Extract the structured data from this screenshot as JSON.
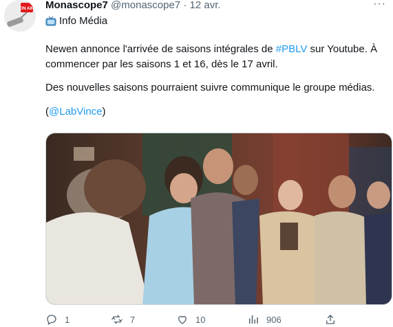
{
  "tweet": {
    "author_name": "Monascope7",
    "author_handle": "@monascope7",
    "separator": "·",
    "date": "12 avr.",
    "more_label": "···",
    "category": "Info Média",
    "text_before_hashtag": "Newen annonce l'arrivée de saisons intégrales de ",
    "hashtag": "#PBLV",
    "text_after_hashtag": " sur Youtube. À commencer par les saisons 1 et 16, dès le 17 avril.",
    "paragraph2": "Des nouvelles saisons pourraient suivre communique le groupe médias.",
    "credit_open": "(",
    "credit_mention": "@LabVince",
    "credit_close": ")"
  },
  "actions": {
    "replies": "1",
    "retweets": "7",
    "likes": "10",
    "views": "906"
  },
  "colors": {
    "link": "#1d9bf0",
    "text": "#0f1419",
    "secondary": "#536471"
  }
}
